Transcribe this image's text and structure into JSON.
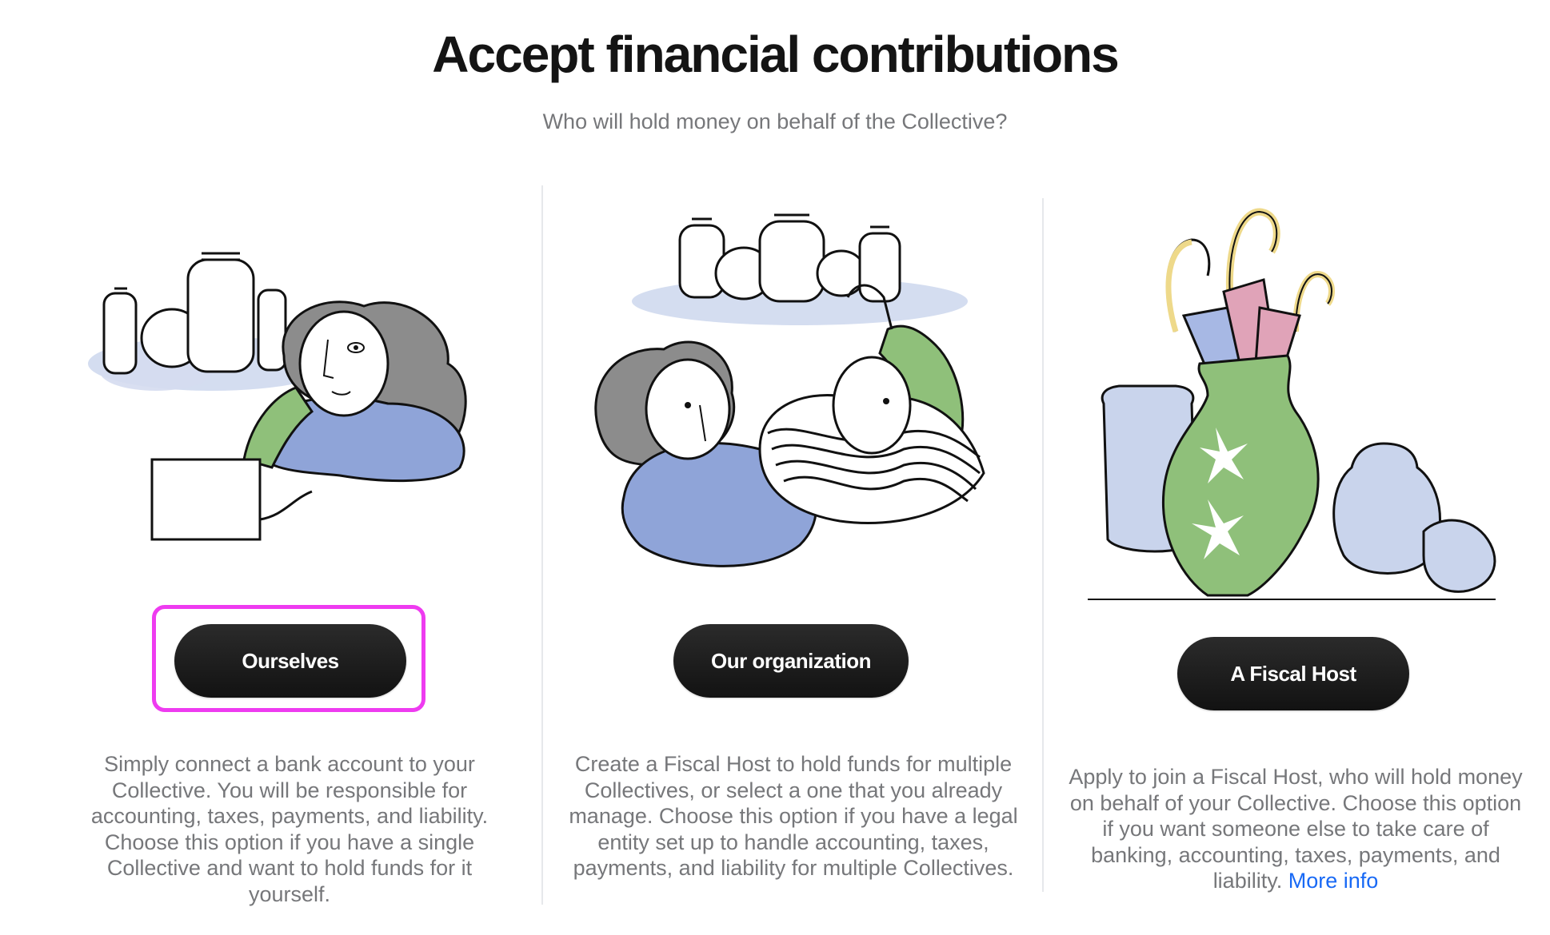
{
  "header": {
    "title": "Accept financial contributions",
    "subtitle": "Who will hold money on behalf of the Collective?"
  },
  "options": [
    {
      "button_label": "Ourselves",
      "illustration": "person-with-laptop-and-jars-illustration",
      "description": "Simply connect a bank account to your Collective. You will be responsible for accounting, taxes, payments, and liability. Choose this option if you have a single Collective and want to hold funds for it yourself."
    },
    {
      "button_label": "Our organization",
      "illustration": "two-people-with-jars-illustration",
      "description": "Create a Fiscal Host to hold funds for multiple Collectives, or select a one that you already manage. Choose this option if you have a legal entity set up to handle accounting, taxes, payments, and liability for multiple Collectives."
    },
    {
      "button_label": "A Fiscal Host",
      "illustration": "vase-with-umbrellas-illustration",
      "description": "Apply to join a Fiscal Host, who will hold money on behalf of your Collective. Choose this option if you want someone else to take care of banking, accounting, taxes, payments, and liability.",
      "link_label": "More info"
    }
  ],
  "colors": {
    "button_bg": "#141414",
    "button_text": "#ffffff",
    "description_text": "#76777a",
    "link": "#1869f5",
    "highlight": "#ee3bf0",
    "illustration_blue": "#8fa4d8",
    "illustration_green": "#8fc07a",
    "illustration_gray": "#8a8a8a",
    "illustration_pink": "#e0a3b8",
    "illustration_yellow": "#eed98a"
  }
}
